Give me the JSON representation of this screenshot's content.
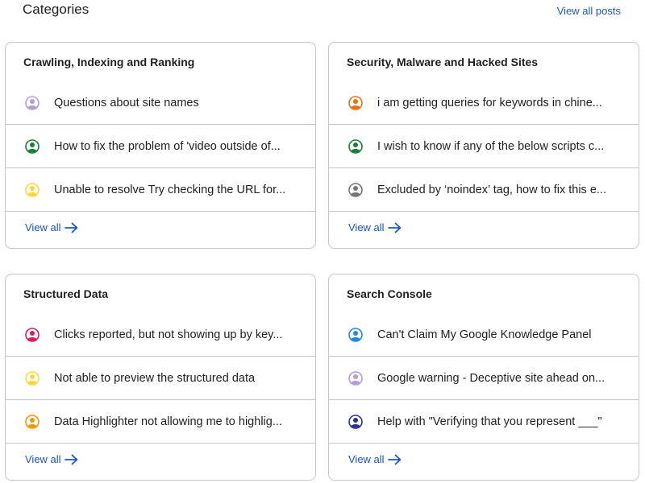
{
  "header": {
    "title": "Categories",
    "view_all_posts": "View all posts"
  },
  "colors": {
    "link": "#1a56c4",
    "border": "#c4c7c5"
  },
  "cards": [
    {
      "title": "Crawling, Indexing and Ranking",
      "rows": [
        {
          "text": "Questions about site names",
          "avatar_color": "#b39ddb"
        },
        {
          "text": "How to fix the problem of 'video outside of...",
          "avatar_color": "#188038"
        },
        {
          "text": "Unable to resolve Try checking the URL for...",
          "avatar_color": "#fdd835"
        }
      ],
      "view_all": "View all"
    },
    {
      "title": "Security, Malware and Hacked Sites",
      "rows": [
        {
          "text": "i am getting queries for keywords in chine...",
          "avatar_color": "#e8710a"
        },
        {
          "text": "I wish to know if any of the below scripts c...",
          "avatar_color": "#188038"
        },
        {
          "text": "Excluded by ‘noindex’ tag, how to fix this e...",
          "avatar_color": "#757575"
        }
      ],
      "view_all": "View all"
    },
    {
      "title": "Structured Data",
      "rows": [
        {
          "text": "Clicks reported, but not showing up by key...",
          "avatar_color": "#d81b60"
        },
        {
          "text": "Not able to preview the structured data",
          "avatar_color": "#fdd835"
        },
        {
          "text": "Data Highlighter not allowing me to highlig...",
          "avatar_color": "#f29900"
        }
      ],
      "view_all": "View all"
    },
    {
      "title": "Search Console",
      "rows": [
        {
          "text": "Can't Claim My Google Knowledge Panel",
          "avatar_color": "#1e88e5"
        },
        {
          "text": "Google warning - Deceptive site ahead on...",
          "avatar_color": "#b39ddb"
        },
        {
          "text": "Help with \"Verifying that you represent ___\"",
          "avatar_color": "#283593"
        }
      ],
      "view_all": "View all"
    }
  ]
}
